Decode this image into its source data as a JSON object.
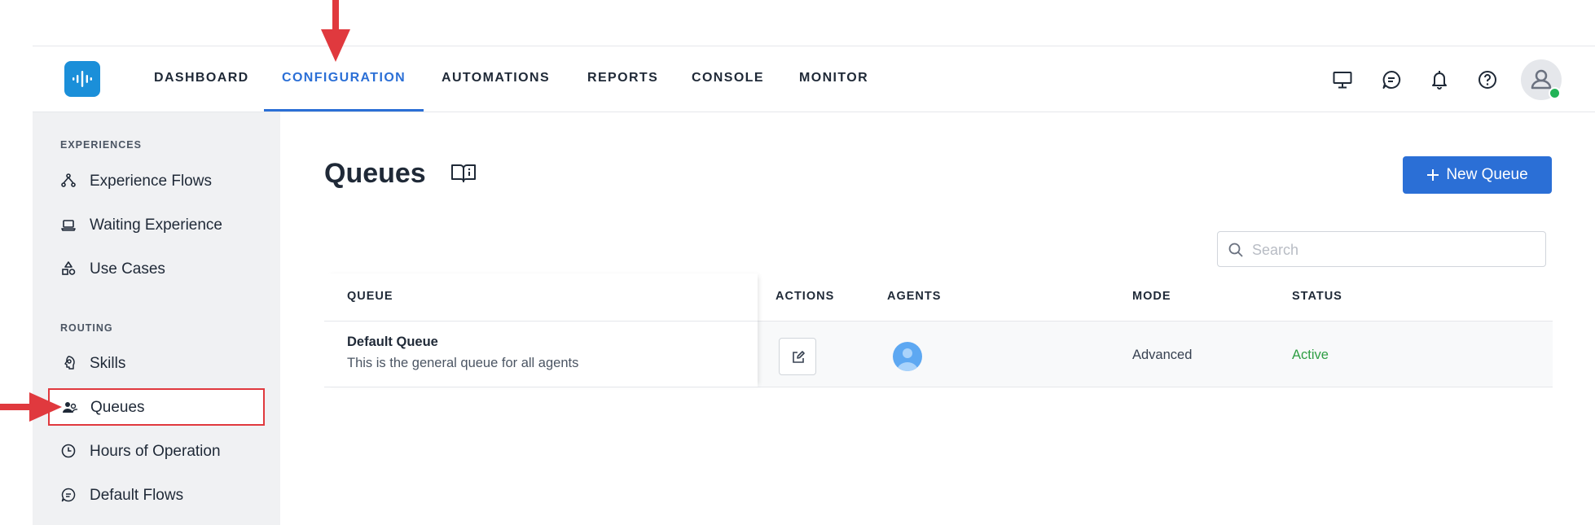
{
  "nav": {
    "items": [
      {
        "label": "DASHBOARD",
        "active": false
      },
      {
        "label": "CONFIGURATION",
        "active": true
      },
      {
        "label": "AUTOMATIONS",
        "active": false
      },
      {
        "label": "REPORTS",
        "active": false
      },
      {
        "label": "CONSOLE",
        "active": false
      },
      {
        "label": "MONITOR",
        "active": false
      }
    ],
    "icons": [
      "monitor-icon",
      "chat-icon",
      "bell-icon",
      "help-icon",
      "user-avatar"
    ]
  },
  "sidebar": {
    "sections": [
      {
        "title": "EXPERIENCES",
        "items": [
          {
            "label": "Experience Flows",
            "icon": "flow-icon"
          },
          {
            "label": "Waiting Experience",
            "icon": "laptop-icon"
          },
          {
            "label": "Use Cases",
            "icon": "shapes-icon"
          }
        ]
      },
      {
        "title": "ROUTING",
        "items": [
          {
            "label": "Skills",
            "icon": "skills-icon"
          },
          {
            "label": "Queues",
            "icon": "users-icon",
            "selected": true
          },
          {
            "label": "Hours of Operation",
            "icon": "clock-icon"
          },
          {
            "label": "Default Flows",
            "icon": "chat-icon"
          }
        ]
      }
    ]
  },
  "page": {
    "title": "Queues",
    "new_button": "New Queue",
    "search_placeholder": "Search"
  },
  "table": {
    "columns": [
      "QUEUE",
      "ACTIONS",
      "AGENTS",
      "MODE",
      "STATUS"
    ],
    "rows": [
      {
        "name": "Default Queue",
        "description": "This is the general queue for all agents",
        "mode": "Advanced",
        "status": "Active"
      }
    ]
  },
  "colors": {
    "accent": "#2b6fd6",
    "status_active": "#2f9e44",
    "highlight": "#e0393e",
    "logo": "#1b8fd9"
  }
}
